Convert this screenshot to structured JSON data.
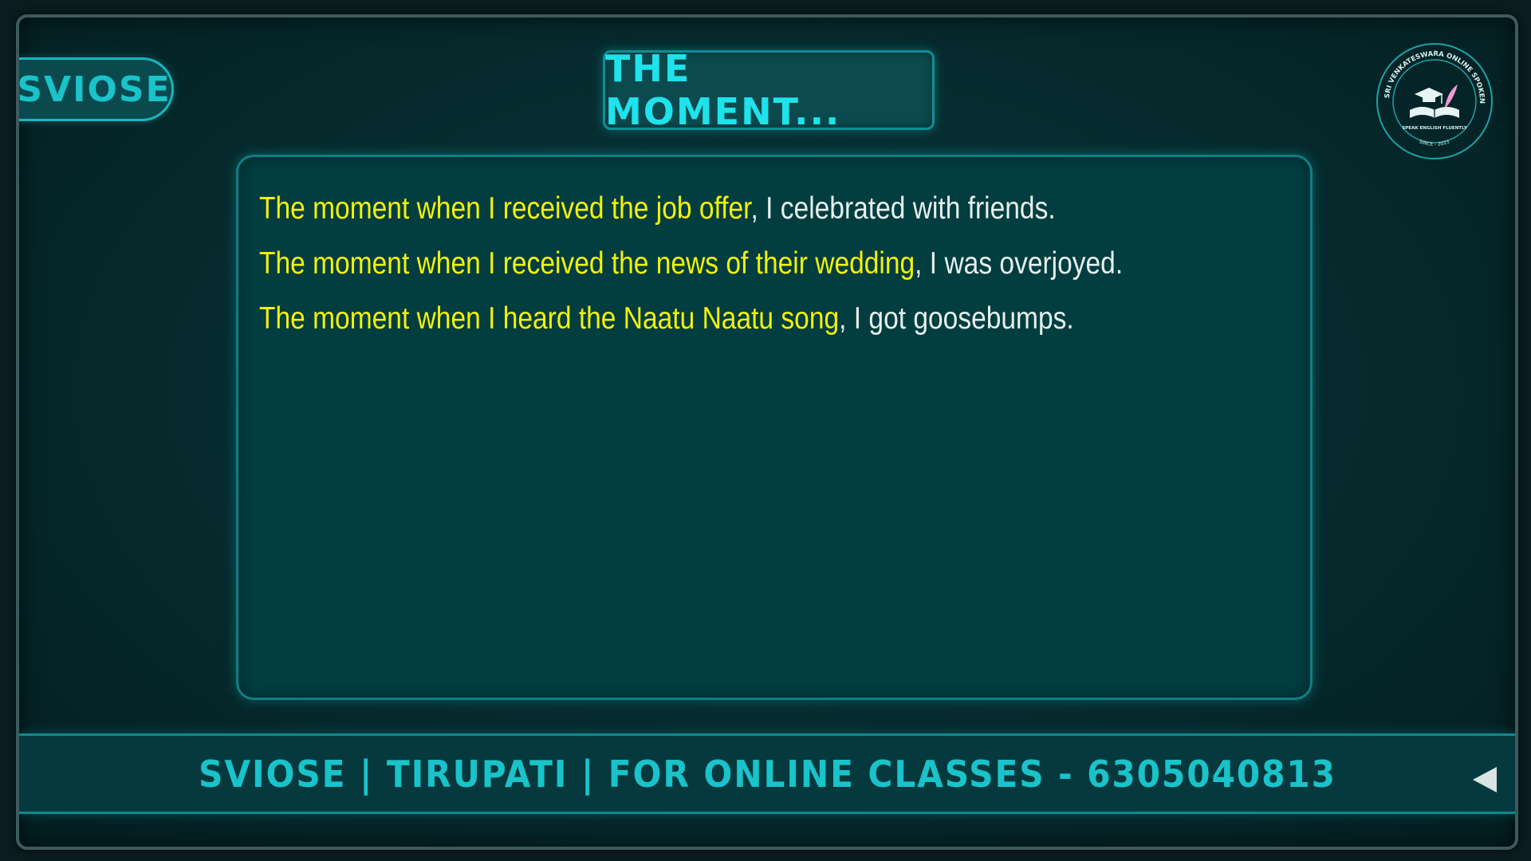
{
  "brand_tab": {
    "label": "SVIOSE"
  },
  "title": "THE MOMENT...",
  "logo": {
    "ring_text": "SRI VENKATESWARA ONLINE SPOKEN ENGLISH SCHOOL",
    "tagline": "SPEAK ENGLISH FLUENTLY",
    "since": "SINCE - 2023",
    "icon": "graduation-book-icon"
  },
  "sentences": [
    {
      "highlight": "The moment when I received the job offer",
      "rest": ", I celebrated with friends."
    },
    {
      "highlight": "The moment when I received the news of their wedding",
      "rest": ", I was overjoyed."
    },
    {
      "highlight": "The moment when I heard the Naatu Naatu song",
      "rest": ", I got goosebumps."
    }
  ],
  "footer": {
    "text": "SVIOSE | TIRUPATI | FOR ONLINE CLASSES - 6305040813"
  },
  "nav": {
    "back_icon": "triangle-left-icon"
  },
  "colors": {
    "highlight": "#f2f20a",
    "body_text": "#e7f0ee",
    "accent": "#19c3c9",
    "panel": "#023d40"
  }
}
